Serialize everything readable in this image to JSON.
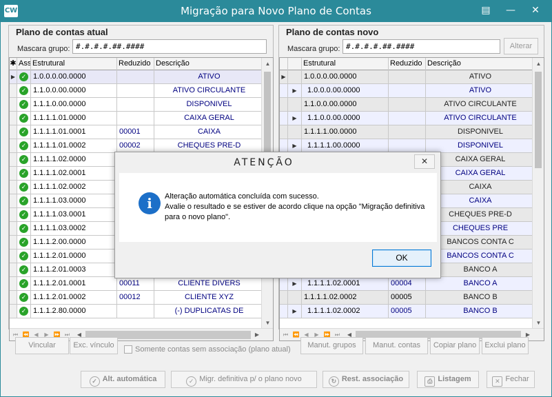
{
  "window": {
    "logo": "CW",
    "title": "Migração para Novo Plano de Contas",
    "icons": {
      "menu": "menu-icon",
      "minimize": "minimize-icon",
      "restore": "restore-icon",
      "close": "close-icon"
    }
  },
  "left": {
    "title": "Plano de contas atual",
    "mask_label": "Mascara grupo:",
    "mask_value": "#.#.#.#.##.####",
    "columns": {
      "assoc": "Ass",
      "estrutural": "Estrutural",
      "reduzido": "Reduzido",
      "descricao": "Descrição"
    },
    "rows": [
      {
        "est": "1.0.0.0.00.0000",
        "red": "",
        "desc": "ATIVO",
        "ind": "▶"
      },
      {
        "est": "1.1.0.0.00.0000",
        "red": "",
        "desc": "ATIVO CIRCULANTE",
        "ind": ""
      },
      {
        "est": "1.1.1.0.00.0000",
        "red": "",
        "desc": "DISPONIVEL",
        "ind": ""
      },
      {
        "est": "1.1.1.1.01.0000",
        "red": "",
        "desc": "CAIXA GERAL",
        "ind": ""
      },
      {
        "est": "1.1.1.1.01.0001",
        "red": "00001",
        "desc": "CAIXA",
        "ind": ""
      },
      {
        "est": "1.1.1.1.01.0002",
        "red": "00002",
        "desc": "CHEQUES PRE-D",
        "ind": ""
      },
      {
        "est": "1.1.1.1.02.0000",
        "red": "",
        "desc": "",
        "ind": ""
      },
      {
        "est": "1.1.1.1.02.0001",
        "red": "",
        "desc": "",
        "ind": ""
      },
      {
        "est": "1.1.1.1.02.0002",
        "red": "",
        "desc": "",
        "ind": ""
      },
      {
        "est": "1.1.1.1.03.0000",
        "red": "",
        "desc": "",
        "ind": ""
      },
      {
        "est": "1.1.1.1.03.0001",
        "red": "",
        "desc": "",
        "ind": ""
      },
      {
        "est": "1.1.1.1.03.0002",
        "red": "",
        "desc": "",
        "ind": ""
      },
      {
        "est": "1.1.1.2.00.0000",
        "red": "",
        "desc": "",
        "ind": ""
      },
      {
        "est": "1.1.1.2.01.0000",
        "red": "",
        "desc": "",
        "ind": ""
      },
      {
        "est": "1.1.1.2.01.0003",
        "red": "",
        "desc": "",
        "ind": ""
      },
      {
        "est": "1.1.1.2.01.0001",
        "red": "00011",
        "desc": "CLIENTE DIVERS",
        "ind": ""
      },
      {
        "est": "1.1.1.2.01.0002",
        "red": "00012",
        "desc": "CLIENTE XYZ",
        "ind": ""
      },
      {
        "est": "1.1.1.2.80.0000",
        "red": "",
        "desc": "(-) DUPLICATAS DE",
        "ind": ""
      }
    ]
  },
  "right": {
    "title": "Plano de contas novo",
    "mask_label": "Mascara grupo:",
    "mask_value": "#.#.#.#.##.####",
    "alterar": "Alterar",
    "columns": {
      "estrutural": "Estrutural",
      "reduzido": "Reduzido",
      "descricao": "Descrição"
    },
    "rows": [
      {
        "est": "1.0.0.0.00.0000",
        "red": "",
        "desc": "ATIVO",
        "kind": "gray",
        "ind": "▶"
      },
      {
        "est": "1.0.0.0.00.0000",
        "red": "",
        "desc": "ATIVO",
        "kind": "blue",
        "ind": "▶"
      },
      {
        "est": "1.1.0.0.00.0000",
        "red": "",
        "desc": "ATIVO CIRCULANTE",
        "kind": "gray",
        "ind": ""
      },
      {
        "est": "1.1.0.0.00.0000",
        "red": "",
        "desc": "ATIVO CIRCULANTE",
        "kind": "blue",
        "ind": "▶"
      },
      {
        "est": "1.1.1.1.00.0000",
        "red": "",
        "desc": "DISPONIVEL",
        "kind": "gray",
        "ind": ""
      },
      {
        "est": "1.1.1.1.00.0000",
        "red": "",
        "desc": "DISPONIVEL",
        "kind": "blue",
        "ind": "▶"
      },
      {
        "est": "",
        "red": "",
        "desc": "CAIXA GERAL",
        "kind": "gray",
        "ind": ""
      },
      {
        "est": "",
        "red": "",
        "desc": "CAIXA GERAL",
        "kind": "blue",
        "ind": ""
      },
      {
        "est": "",
        "red": "",
        "desc": "CAIXA",
        "kind": "gray",
        "ind": ""
      },
      {
        "est": "",
        "red": "",
        "desc": "CAIXA",
        "kind": "blue",
        "ind": ""
      },
      {
        "est": "",
        "red": "",
        "desc": "CHEQUES PRE-D",
        "kind": "gray",
        "ind": ""
      },
      {
        "est": "",
        "red": "",
        "desc": "CHEQUES PRE",
        "kind": "blue",
        "ind": ""
      },
      {
        "est": "",
        "red": "",
        "desc": "BANCOS CONTA C",
        "kind": "gray",
        "ind": ""
      },
      {
        "est": "",
        "red": "",
        "desc": "BANCOS CONTA C",
        "kind": "blue",
        "ind": ""
      },
      {
        "est": "",
        "red": "",
        "desc": "BANCO A",
        "kind": "gray",
        "ind": ""
      },
      {
        "est": "1.1.1.1.02.0001",
        "red": "00004",
        "desc": "BANCO A",
        "kind": "blue",
        "ind": "▶"
      },
      {
        "est": "1.1.1.1.02.0002",
        "red": "00005",
        "desc": "BANCO B",
        "kind": "gray",
        "ind": ""
      },
      {
        "est": "1.1.1.1.02.0002",
        "red": "00005",
        "desc": "BANCO B",
        "kind": "blue",
        "ind": "▶"
      }
    ]
  },
  "actions": {
    "vincular": "Vincular",
    "exc_vinculo": "Exc. vínculo",
    "somente": "Somente contas sem associação (plano atual)",
    "manut_grupos": "Manut. grupos",
    "manut_contas": "Manut. contas",
    "copiar_plano": "Copiar plano",
    "exclui_plano": "Exclui plano"
  },
  "bottom": {
    "alt_auto": "Alt. automática",
    "migr": "Migr. definitiva p/ o plano novo",
    "rest": "Rest. associação",
    "listagem": "Listagem",
    "fechar": "Fechar"
  },
  "dialog": {
    "title": "ATENÇÃO",
    "line1": "Alteração automática concluída com sucesso.",
    "line2": "Avalie o resultado e se estiver de acordo clique na opção \"Migração definitiva para o novo plano\".",
    "ok": "OK",
    "icon": "info-icon"
  }
}
